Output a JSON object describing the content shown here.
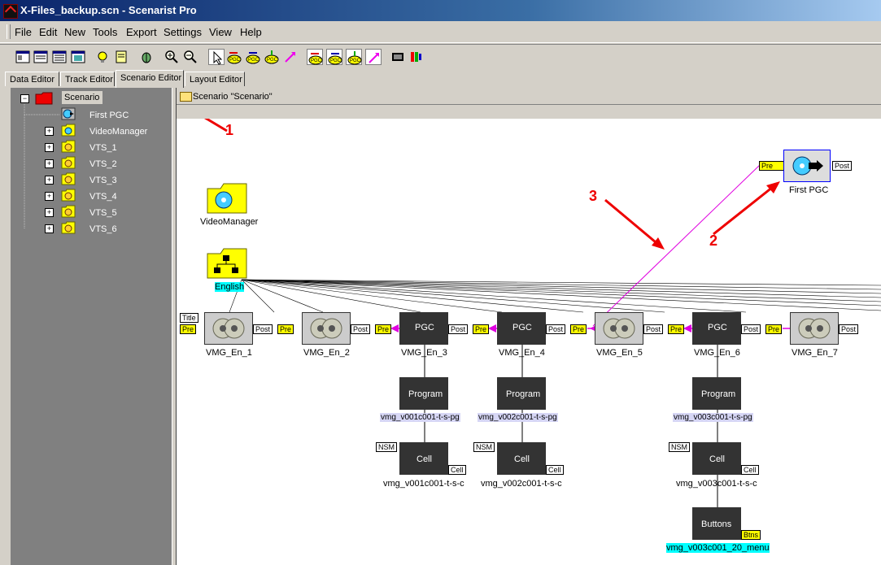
{
  "window": {
    "title": "X-Files_backup.scn - Scenarist Pro"
  },
  "menu": [
    "File",
    "Edit",
    "New",
    "Tools",
    "Export",
    "Settings",
    "View",
    "Help"
  ],
  "tabs": [
    "Data Editor",
    "Track Editor",
    "Scenario Editor",
    "Layout Editor"
  ],
  "tree": {
    "root": "Scenario",
    "items": [
      "First PGC",
      "VideoManager",
      "VTS_1",
      "VTS_2",
      "VTS_3",
      "VTS_4",
      "VTS_5",
      "VTS_6"
    ]
  },
  "panel_header": "Scenario \"Scenario\"",
  "canvas": {
    "first_pgc": {
      "label": "First PGC",
      "pre": "Pre",
      "post": "Post"
    },
    "video_manager": "VideoManager",
    "language": "English",
    "title_tag": "Title",
    "pgcs": [
      {
        "label": "VMG_En_1",
        "pre": "Pre",
        "post": "Post"
      },
      {
        "label": "VMG_En_2",
        "pre": "Pre",
        "post": "Post"
      },
      {
        "label": "VMG_En_3",
        "pre": "Pre",
        "post": "Post"
      },
      {
        "label": "VMG_En_4",
        "pre": "Pre",
        "post": "Post"
      },
      {
        "label": "VMG_En_5",
        "pre": "Pre",
        "post": "Post"
      },
      {
        "label": "VMG_En_6",
        "pre": "Pre",
        "post": "Post"
      },
      {
        "label": "VMG_En_7",
        "pre": "Pre",
        "post": "Post"
      }
    ],
    "pgc_center_text": "PGC",
    "programs": [
      {
        "text": "Program",
        "label": "vmg_v001c001-t-s-pg"
      },
      {
        "text": "Program",
        "label": "vmg_v002c001-t-s-pg"
      },
      {
        "text": "Program",
        "label": "vmg_v003c001-t-s-pg"
      }
    ],
    "cells": [
      {
        "text": "Cell",
        "nsm": "NSM",
        "tag": "Cell",
        "label": "vmg_v001c001-t-s-c"
      },
      {
        "text": "Cell",
        "nsm": "NSM",
        "tag": "Cell",
        "label": "vmg_v002c001-t-s-c"
      },
      {
        "text": "Cell",
        "nsm": "NSM",
        "tag": "Cell",
        "label": "vmg_v003c001-t-s-c"
      }
    ],
    "buttons": {
      "text": "Buttons",
      "tag": "Btns",
      "label": "vmg_v003c001_20_menu"
    },
    "annotations": [
      "1",
      "2",
      "3"
    ]
  }
}
